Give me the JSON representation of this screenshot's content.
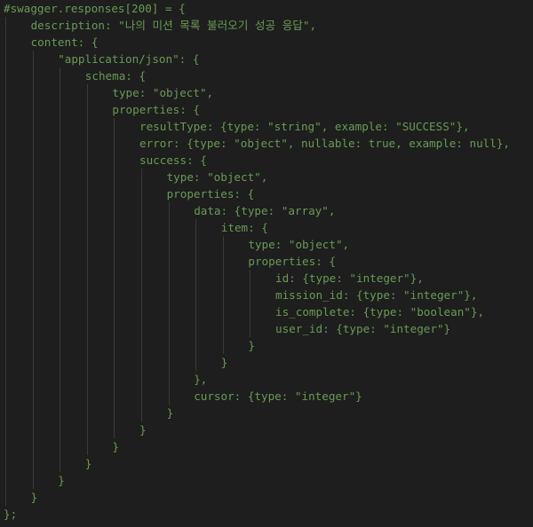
{
  "code": {
    "language": "python",
    "comment_color": "#6a9955",
    "background": "#1e1e1e",
    "lines": [
      {
        "indent": 0,
        "text": "#swagger.responses[200] = {"
      },
      {
        "indent": 1,
        "text": "description: \"나의 미션 목록 불러오기 성공 응답\","
      },
      {
        "indent": 1,
        "text": "content: {"
      },
      {
        "indent": 2,
        "text": "\"application/json\": {"
      },
      {
        "indent": 3,
        "text": "schema: {"
      },
      {
        "indent": 4,
        "text": "type: \"object\","
      },
      {
        "indent": 4,
        "text": "properties: {"
      },
      {
        "indent": 5,
        "text": "resultType: {type: \"string\", example: \"SUCCESS\"},"
      },
      {
        "indent": 5,
        "text": "error: {type: \"object\", nullable: true, example: null},"
      },
      {
        "indent": 5,
        "text": "success: {"
      },
      {
        "indent": 6,
        "text": "type: \"object\","
      },
      {
        "indent": 6,
        "text": "properties: {"
      },
      {
        "indent": 7,
        "text": "data: {type: \"array\","
      },
      {
        "indent": 8,
        "text": "item: {"
      },
      {
        "indent": 9,
        "text": "type: \"object\","
      },
      {
        "indent": 9,
        "text": "properties: {"
      },
      {
        "indent": 10,
        "text": "id: {type: \"integer\"},"
      },
      {
        "indent": 10,
        "text": "mission_id: {type: \"integer\"},"
      },
      {
        "indent": 10,
        "text": "is_complete: {type: \"boolean\"},"
      },
      {
        "indent": 10,
        "text": "user_id: {type: \"integer\"}"
      },
      {
        "indent": 9,
        "text": "}"
      },
      {
        "indent": 8,
        "text": "}"
      },
      {
        "indent": 7,
        "text": "},"
      },
      {
        "indent": 7,
        "text": "cursor: {type: \"integer\"}"
      },
      {
        "indent": 6,
        "text": "}"
      },
      {
        "indent": 5,
        "text": "}"
      },
      {
        "indent": 4,
        "text": "}"
      },
      {
        "indent": 3,
        "text": "}"
      },
      {
        "indent": 2,
        "text": "}"
      },
      {
        "indent": 1,
        "text": "}"
      },
      {
        "indent": 0,
        "text": "};"
      }
    ]
  }
}
